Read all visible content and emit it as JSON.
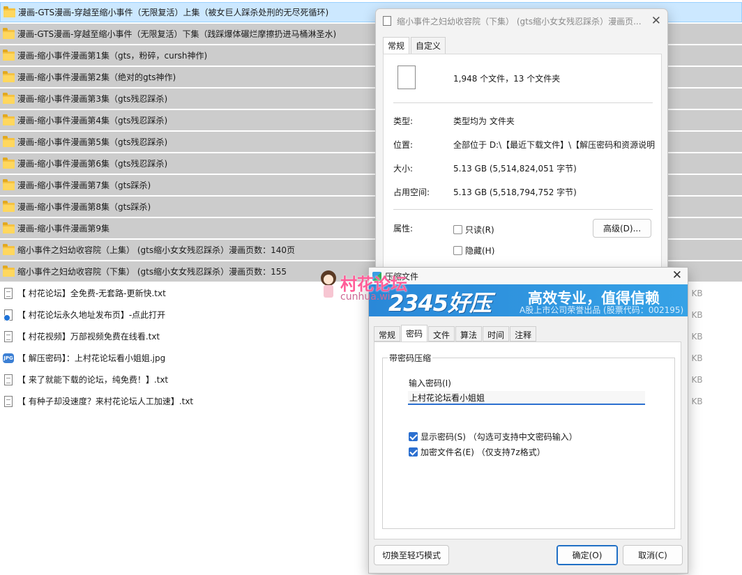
{
  "file_list": {
    "rows": [
      {
        "type": "folder",
        "name": "漫画-GTS漫画-穿越至缩小事件（无限复活）上集（被女巨人踩杀处刑的无尽死循环)",
        "state": "highlight"
      },
      {
        "type": "folder",
        "name": "漫画-GTS漫画-穿越至缩小事件（无限复活）下集（践踩爆体碾烂摩擦扔进马桶淋圣水)",
        "state": "selected"
      },
      {
        "type": "folder",
        "name": "漫画-缩小事件漫画第1集（gts，粉碎，cursh神作)",
        "state": "selected"
      },
      {
        "type": "folder",
        "name": "漫画-缩小事件漫画第2集（绝对的gts神作)",
        "state": "selected"
      },
      {
        "type": "folder",
        "name": "漫画-缩小事件漫画第3集（gts残忍踩杀)",
        "state": "selected"
      },
      {
        "type": "folder",
        "name": "漫画-缩小事件漫画第4集（gts残忍踩杀)",
        "state": "selected"
      },
      {
        "type": "folder",
        "name": "漫画-缩小事件漫画第5集（gts残忍踩杀)",
        "state": "selected"
      },
      {
        "type": "folder",
        "name": "漫画-缩小事件漫画第6集（gts残忍踩杀)",
        "state": "selected"
      },
      {
        "type": "folder",
        "name": "漫画-缩小事件漫画第7集（gts踩杀)",
        "state": "selected"
      },
      {
        "type": "folder",
        "name": "漫画-缩小事件漫画第8集（gts踩杀)",
        "state": "selected"
      },
      {
        "type": "folder",
        "name": "漫画-缩小事件漫画第9集",
        "state": "selected"
      },
      {
        "type": "folder",
        "name": "缩小事件之妇幼收容院（上集） (gts缩小女女残忍踩杀）漫画页数：140页",
        "state": "selected"
      },
      {
        "type": "folder",
        "name": "缩小事件之妇幼收容院（下集） (gts缩小女女残忍踩杀）漫画页数：155",
        "state": "selected"
      },
      {
        "type": "txt",
        "name": "【 村花论坛】全免费-无套路-更新快.txt",
        "size": "2 KB"
      },
      {
        "type": "html",
        "name": "【 村花论坛永久地址发布页】-点此打开",
        "size": "2 KB"
      },
      {
        "type": "txt",
        "name": "【 村花视频】万部视频免费在线看.txt",
        "size": "2 KB"
      },
      {
        "type": "jpg",
        "name": "【 解压密码】：上村花论坛看小姐姐.jpg",
        "size": "0 KB"
      },
      {
        "type": "txt",
        "name": "【 来了就能下载的论坛，纯免费！】.txt",
        "size": "2 KB"
      },
      {
        "type": "txt",
        "name": "【 有种子却没速度？来村花论坛人工加速】.txt",
        "size": "2 KB"
      }
    ]
  },
  "properties_dialog": {
    "title": "缩小事件之妇幼收容院（下集） (gts缩小女女残忍踩杀）漫画页...",
    "tabs": [
      "常规",
      "自定义"
    ],
    "summary": "1,948 个文件，13 个文件夹",
    "type_label": "类型:",
    "type_value": "类型均为 文件夹",
    "location_label": "位置:",
    "location_value": "全部位于 D:\\【最近下载文件】\\【解压密码和资源说明",
    "size_label": "大小:",
    "size_value": "5.13 GB (5,514,824,051 字节)",
    "disk_label": "占用空间:",
    "disk_value": "5.13 GB (5,518,794,752 字节)",
    "attr_label": "属性:",
    "readonly_label": "只读(R)",
    "hidden_label": "隐藏(H)",
    "advanced_button": "高级(D)..."
  },
  "compress_dialog": {
    "title": "压缩文件",
    "banner": {
      "brand": "2345好压",
      "slogan": "高效专业，值得信赖",
      "stock": "A股上市公司荣誉出品 (股票代码：002195)"
    },
    "tabs": [
      "常规",
      "密码",
      "文件",
      "算法",
      "时间",
      "注释"
    ],
    "active_tab": 1,
    "group_title": "带密码压缩",
    "password_label": "输入密码(I)",
    "password_value": "上村花论坛看小姐姐",
    "show_password_label": "显示密码(S) （勾选可支持中文密码输入）",
    "show_password_checked": true,
    "encrypt_names_label": "加密文件名(E) （仅支持7z格式）",
    "encrypt_names_checked": true,
    "light_mode_button": "切换至轻巧模式",
    "ok_button": "确定(O)",
    "cancel_button": "取消(C)"
  },
  "watermark": {
    "title": "村花论坛",
    "url": "cunhua.wi"
  }
}
